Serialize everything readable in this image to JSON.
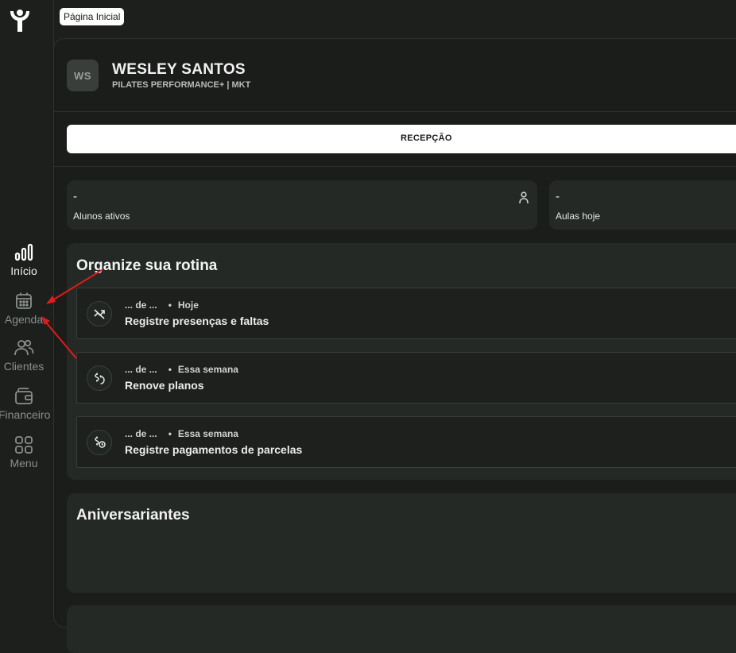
{
  "breadcrumb": "Página Inicial",
  "sidebar": {
    "items": [
      {
        "label": "Início",
        "icon": "bar-chart-icon",
        "active": true
      },
      {
        "label": "Agenda",
        "icon": "calendar-icon",
        "active": false
      },
      {
        "label": "Clientes",
        "icon": "users-icon",
        "active": false
      },
      {
        "label": "Financeiro",
        "icon": "wallet-icon",
        "active": false
      },
      {
        "label": "Menu",
        "icon": "grid-icon",
        "active": false
      }
    ]
  },
  "profile": {
    "initials": "WS",
    "name": "WESLEY SANTOS",
    "subtitle": "PILATES PERFORMANCE+ | MKT"
  },
  "reception_button": "RECEPÇÃO",
  "stats": [
    {
      "value": "-",
      "label": "Alunos ativos",
      "icon": "person-icon"
    },
    {
      "value": "-",
      "label": "Aulas hoje"
    }
  ],
  "routine": {
    "title": "Organize sua rotina",
    "tasks": [
      {
        "count": "... de ...",
        "period": "Hoje",
        "title": "Registre presenças e faltas",
        "icon": "attendance-icon"
      },
      {
        "count": "... de ...",
        "period": "Essa semana",
        "title": "Renove planos",
        "icon": "renew-money-icon"
      },
      {
        "count": "... de ...",
        "period": "Essa semana",
        "title": "Registre pagamentos de parcelas",
        "icon": "installment-money-icon"
      }
    ]
  },
  "birthdays": {
    "title": "Aniversariantes"
  },
  "colors": {
    "background": "#1c1f1c",
    "card": "#252925",
    "annotation_arrow": "#e01b1b"
  }
}
